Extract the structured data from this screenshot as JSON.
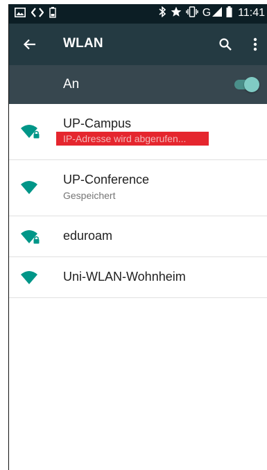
{
  "status_bar": {
    "time": "11:41",
    "network_type": "G",
    "left_icons": [
      "gallery-icon",
      "code-icon",
      "battery-low-icon"
    ],
    "right_icons": [
      "bluetooth-icon",
      "star-icon",
      "vibrate-icon",
      "signal-icon",
      "battery-icon"
    ]
  },
  "app_bar": {
    "title": "WLAN",
    "back_icon": "arrow-back-icon",
    "search_icon": "search-icon",
    "overflow_icon": "more-vert-icon"
  },
  "master_switch": {
    "label": "An",
    "state": "on"
  },
  "networks": [
    {
      "ssid": "UP-Campus",
      "status": "IP-Adresse wird abgerufen...",
      "secured": true,
      "highlighted": true
    },
    {
      "ssid": "UP-Conference",
      "status": "Gespeichert",
      "secured": false,
      "highlighted": false
    },
    {
      "ssid": "eduroam",
      "status": "",
      "secured": true,
      "highlighted": false
    },
    {
      "ssid": "Uni-WLAN-Wohnheim",
      "status": "",
      "secured": false,
      "highlighted": false
    }
  ],
  "colors": {
    "status_bar_bg": "#0c1e25",
    "app_bar_bg": "#243a42",
    "switch_bar_bg": "#37474f",
    "accent": "#009688",
    "toggle_thumb": "#80cbc4",
    "highlight_red": "#e5262e"
  }
}
